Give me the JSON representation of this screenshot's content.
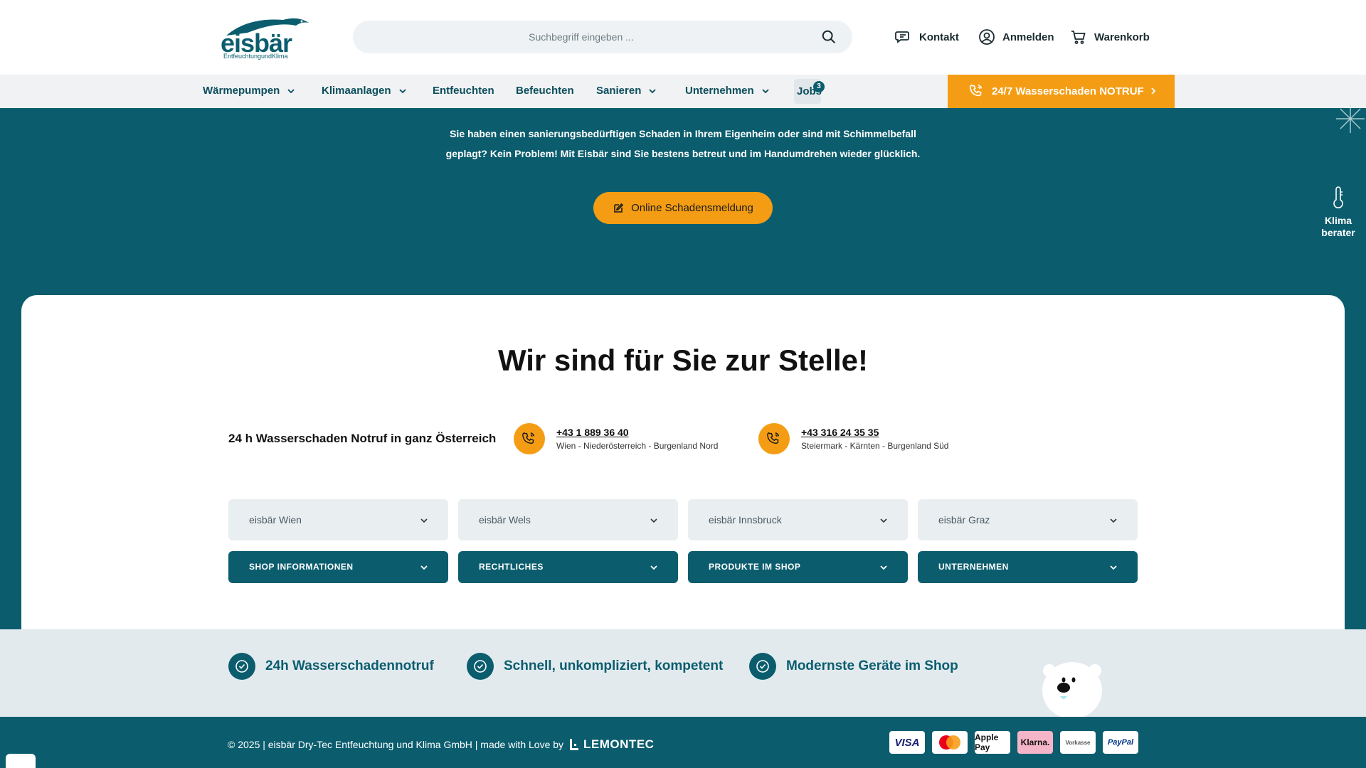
{
  "header": {
    "logo_text": "eisbär",
    "logo_sub": "EntfeuchtungundKlima",
    "search_placeholder": "Suchbegriff eingeben ...",
    "links": {
      "contact": "Kontakt",
      "login": "Anmelden",
      "cart": "Warenkorb"
    }
  },
  "nav": {
    "items": [
      "Wärmepumpen",
      "Klimaanlagen",
      "Entfeuchten",
      "Befeuchten",
      "Sanieren",
      "Unternehmen"
    ],
    "jobs_label": "Jobs",
    "jobs_count": "3",
    "emergency_label": "24/7 Wasserschaden NOTRUF"
  },
  "hero": {
    "text_line1": "Sie haben einen sanierungsbedürftigen Schaden in Ihrem Eigenheim oder sind mit Schimmelbefall",
    "text_line2": "geplagt? Kein Problem! Mit Eisbär sind Sie bestens betreut und im Handumdrehen wieder glücklich.",
    "button_label": "Online Schadensmeldung",
    "advisor_line1": "Klima",
    "advisor_line2": "berater"
  },
  "contact": {
    "title": "Wir sind für Sie zur Stelle!",
    "emergency_text": "24 h Wasserschaden Notruf in ganz Österreich",
    "phones": [
      {
        "number": "+43 1 889 36 40",
        "area": "Wien - Niederösterreich - Burgenland Nord"
      },
      {
        "number": "+43 316 24 35 35",
        "area": "Steiermark - Kärnten - Burgenland Süd"
      }
    ]
  },
  "locations": [
    "eisbär Wien",
    "eisbär Wels",
    "eisbär Innsbruck",
    "eisbär Graz"
  ],
  "footer_menus": [
    "SHOP INFORMATIONEN",
    "RECHTLICHES",
    "PRODUKTE IM SHOP",
    "UNTERNEHMEN"
  ],
  "features": [
    "24h Wasserschadennotruf",
    "Schnell, unkompliziert, kompetent",
    "Modernste Geräte im Shop"
  ],
  "footer": {
    "copyright": "© 2025 | eisbär Dry-Tec Entfeuchtung und Klima GmbH | made with Love by",
    "agency": "LEMONTEC",
    "payments": [
      "VISA",
      "Mastercard",
      "Apple Pay",
      "Klarna.",
      "Vorkasse",
      "PayPal"
    ]
  },
  "colors": {
    "brand_teal": "#0b5d6e",
    "accent_orange": "#f49d14",
    "klarna_pink": "#f5b5c8"
  }
}
